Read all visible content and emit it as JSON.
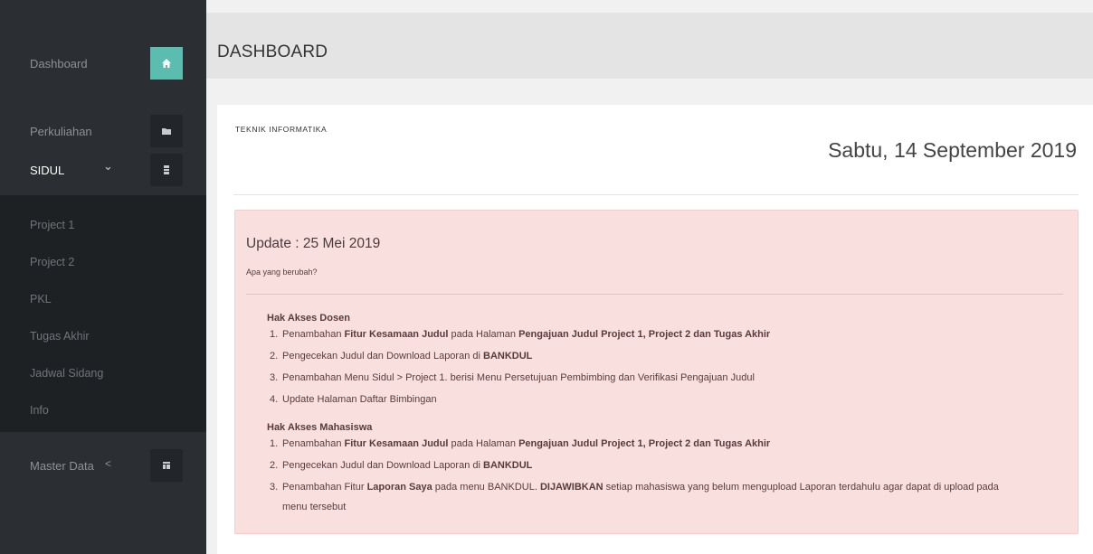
{
  "sidebar": {
    "dashboard": {
      "label": "Dashboard",
      "icon": "home-icon"
    },
    "perkuliahan": {
      "label": "Perkuliahan",
      "icon": "folder-icon"
    },
    "sidul": {
      "label": "SIDUL",
      "icon": "server-icon",
      "caret": "⌄"
    },
    "sub_items": [
      "Project 1",
      "Project 2",
      "PKL",
      "Tugas Akhir",
      "Jadwal Sidang",
      "Info"
    ],
    "master": {
      "label": "Master Data",
      "caret": "<",
      "icon": "table-icon"
    }
  },
  "header": {
    "title": "DASHBOARD"
  },
  "panel": {
    "dept": "TEKNIK INFORMATIKA",
    "date": "Sabtu, 14 September 2019"
  },
  "alert": {
    "update": "Update : 25 Mei 2019",
    "question": "Apa yang berubah?",
    "groups": [
      {
        "title": "Hak Akses Dosen",
        "items": [
          [
            "1.",
            "Penambahan ",
            "Fitur Kesamaan Judul",
            " pada Halaman ",
            "Pengajuan Judul Project 1, Project 2 dan Tugas Akhir",
            ""
          ],
          [
            "2.",
            "Pengecekan Judul dan Download Laporan di ",
            "BANKDUL",
            "",
            "",
            ""
          ],
          [
            "3.",
            "Penambahan Menu Sidul > Project 1. berisi Menu Persetujuan Pembimbing dan Verifikasi Pengajuan Judul",
            "",
            "",
            "",
            ""
          ],
          [
            "4.",
            "Update Halaman Daftar Bimbingan",
            "",
            "",
            "",
            ""
          ]
        ]
      },
      {
        "title": "Hak Akses Mahasiswa",
        "items": [
          [
            "1.",
            "Penambahan ",
            "Fitur Kesamaan Judul",
            " pada Halaman ",
            "Pengajuan Judul Project 1, Project 2 dan Tugas Akhir",
            ""
          ],
          [
            "2.",
            "Pengecekan Judul dan Download Laporan di ",
            "BANKDUL",
            "",
            "",
            ""
          ],
          [
            "3.",
            "Penambahan Fitur ",
            "Laporan Saya",
            " pada menu BANKDUL. ",
            "DIJAWIBKAN",
            " setiap mahasiswa yang belum mengupload Laporan terdahulu agar dapat di upload pada"
          ]
        ],
        "wrap": "menu tersebut"
      }
    ]
  }
}
